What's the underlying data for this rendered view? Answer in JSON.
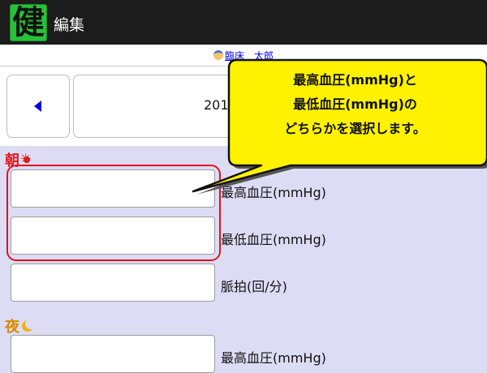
{
  "app": {
    "icon_glyph": "健",
    "title": "編集"
  },
  "user": {
    "name": "臨床　太郎"
  },
  "nav": {
    "date_text": "201"
  },
  "morning": {
    "title": "朝",
    "fields": [
      {
        "label": "最高血圧(mmHg)",
        "value": ""
      },
      {
        "label": "最低血圧(mmHg)",
        "value": ""
      },
      {
        "label": "脈拍(回/分)",
        "value": ""
      }
    ]
  },
  "night": {
    "title": "夜",
    "fields": [
      {
        "label": "最高血圧(mmHg)",
        "value": ""
      }
    ]
  },
  "callout": {
    "lines": [
      "最高血圧(mmHg)と",
      "最低血圧(mmHg)の",
      "どちらかを選択します。"
    ]
  },
  "colors": {
    "app_icon_bg": "#27c23a",
    "page_bg": "#dcdcf4",
    "highlight": "#e4101b",
    "callout_fill": "#fff200",
    "morning_title": "#e51919",
    "night_title": "#d88a00",
    "nav_arrow": "#0000dd"
  },
  "icons": [
    "sun-icon",
    "moon-icon",
    "prev-arrow-icon",
    "user-avatar-icon"
  ]
}
